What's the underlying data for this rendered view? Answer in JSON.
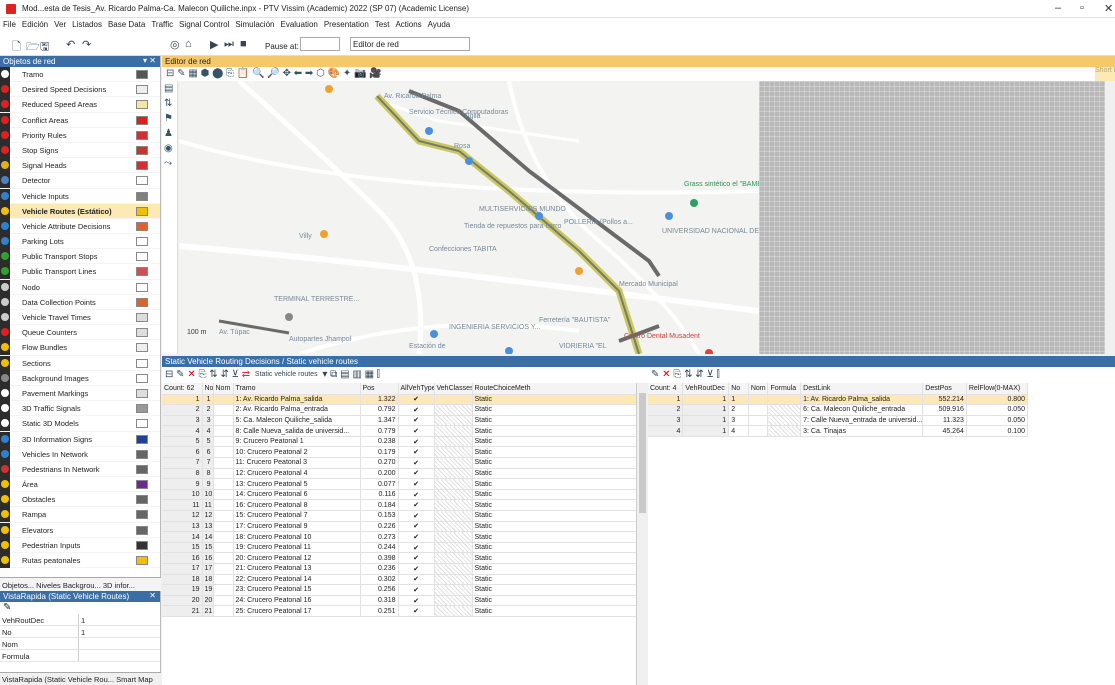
{
  "title": "Mod...esta de Tesis_Av. Ricardo Palma-Ca. Malecon Quiliche.inpx - PTV Vissim (Academic) 2022 (SP 07) (Academic License)",
  "menu": [
    "File",
    "Edición",
    "Ver",
    "Listados",
    "Base Data",
    "Traffic",
    "Signal Control",
    "Simulación",
    "Evaluation",
    "Presentation",
    "Test",
    "Actions",
    "Ayuda"
  ],
  "toolbar": {
    "pause_label": "Pause at:",
    "editor_select": "Editor de red"
  },
  "left_panel": {
    "title": "Objetos de red",
    "items": [
      {
        "label": "Tramo",
        "color": "#555555",
        "icon": "#ffffff"
      },
      {
        "label": "Desired Speed Decisions",
        "color": "#eeeeee",
        "icon": "#e02020"
      },
      {
        "label": "Reduced Speed Areas",
        "color": "#f4e7a1",
        "icon": "#e02020"
      },
      {
        "label": "Conflict Areas",
        "color": "#e02020",
        "icon": "#e02020"
      },
      {
        "label": "Priority Rules",
        "color": "#d03030",
        "icon": "#e02020"
      },
      {
        "label": "Stop Signs",
        "color": "#d03030",
        "icon": "#e02020"
      },
      {
        "label": "Signal Heads",
        "color": "#d03030",
        "icon": "#e0b020"
      },
      {
        "label": "Detector",
        "color": "#ffffff",
        "icon": "#5080c0"
      },
      {
        "label": "Vehicle Inputs",
        "color": "#808080",
        "icon": "#3080d0"
      },
      {
        "label": "Vehicle Routes (Estático)",
        "color": "#f0c000",
        "icon": "#f0c000",
        "selected": true
      },
      {
        "label": "Vehicle Attribute Decisions",
        "color": "#e06030",
        "icon": "#3080d0"
      },
      {
        "label": "Parking Lots",
        "color": "#ffffff",
        "icon": "#3080d0"
      },
      {
        "label": "Public Transport Stops",
        "color": "#ffffff",
        "icon": "#30a030"
      },
      {
        "label": "Public Transport Lines",
        "color": "#d05050",
        "icon": "#30a030"
      },
      {
        "label": "Nodo",
        "color": "#ffffff",
        "icon": "#cccccc"
      },
      {
        "label": "Data Collection Points",
        "color": "#e06030",
        "icon": "#cccccc"
      },
      {
        "label": "Vehicle Travel Times",
        "color": "#dddddd",
        "icon": "#cccccc"
      },
      {
        "label": "Queue Counters",
        "color": "#dddddd",
        "icon": "#e02020"
      },
      {
        "label": "Flow Bundles",
        "color": "#eeeeee",
        "icon": "#f0c000"
      },
      {
        "label": "Sections",
        "color": "#ffffff",
        "icon": "#f0c000"
      },
      {
        "label": "Background Images",
        "color": "#ffffff",
        "icon": "#888888"
      },
      {
        "label": "Pavement Markings",
        "color": "#dddddd",
        "icon": "#ffffff"
      },
      {
        "label": "3D Traffic Signals",
        "color": "#999999",
        "icon": "#ffffff"
      },
      {
        "label": "Static 3D Models",
        "color": "#ffffff",
        "icon": "#ffffff"
      },
      {
        "label": "3D Information Signs",
        "color": "#2040a0",
        "icon": "#3080d0"
      },
      {
        "label": "Vehicles In Network",
        "color": "#666666",
        "icon": "#3080d0"
      },
      {
        "label": "Pedestrians In Network",
        "color": "#666666",
        "icon": "#d03030"
      },
      {
        "label": "Área",
        "color": "#6a2a90",
        "icon": "#f0c000"
      },
      {
        "label": "Obstacles",
        "color": "#666666",
        "icon": "#f0c000"
      },
      {
        "label": "Rampa",
        "color": "#666666",
        "icon": "#f0c000"
      },
      {
        "label": "Elevators",
        "color": "#666666",
        "icon": "#f0c000"
      },
      {
        "label": "Pedestrian Inputs",
        "color": "#333333",
        "icon": "#f0c000"
      },
      {
        "label": "Rutas peatonales",
        "color": "#f0c000",
        "icon": "#f0c000"
      }
    ],
    "tabs": "Objetos... Niveles Backgrou... 3D infor..."
  },
  "quick_view": {
    "title": "VistaRapida (Static Vehicle Routes)",
    "rows": [
      {
        "k": "VehRoutDec",
        "v": "1"
      },
      {
        "k": "No",
        "v": "1"
      },
      {
        "k": "Nom",
        "v": ""
      },
      {
        "k": "Formula",
        "v": ""
      }
    ],
    "tabs": "VistaRapida (Static Vehicle Rou... Smart Map"
  },
  "editor": {
    "title": "Editor de red",
    "short": "Short h",
    "scale": "100 m",
    "map_labels": [
      "Servicio Técnico Computadoras",
      "Tiglla",
      "Rosa",
      "MULTISERVICIOS MUNDO",
      "Tienda de repuestos para carro",
      "Villy",
      "Confecciones TABITA",
      "TERMINAL TERRESTRE...",
      "Autopartes Jhampol",
      "Estación de",
      "INGENIERIA SERVICIOS Y...",
      "Ferretería \"BAUTISTA\"",
      "VIDRIERIA \"EL",
      "Centro Dental Musadent",
      "Mercado Municipal",
      "UNIVERSIDAD NACIONAL DE...",
      "Grass sintético el \"BAMBACHO\"",
      "POLLERÍA (Pollos a...",
      "Av. Ricardo Palma",
      "Av. Túpac"
    ]
  },
  "routing": {
    "title": "Static Vehicle Routing Decisions / Static vehicle routes",
    "dropdown": "Static vehicle routes",
    "left_headers": [
      "Count: 62",
      "No",
      "Nom",
      "Tramo",
      "Pos",
      "AllVehTypes",
      "VehClasses",
      "RouteChoiceMeth"
    ],
    "left_rows": [
      [
        "1",
        "1",
        "",
        "1: Av. Ricardo Palma_salida",
        "1.322",
        "✔",
        "",
        "Static"
      ],
      [
        "2",
        "2",
        "",
        "2: Av. Ricardo Palma_entrada",
        "0.792",
        "✔",
        "",
        "Static"
      ],
      [
        "3",
        "3",
        "",
        "5: Ca. Malecon Quiliche_salida",
        "1.347",
        "✔",
        "",
        "Static"
      ],
      [
        "4",
        "4",
        "",
        "8: Calle Nueva_salida de universid...",
        "0.779",
        "✔",
        "",
        "Static"
      ],
      [
        "5",
        "5",
        "",
        "9: Crucero Peatonal 1",
        "0.238",
        "✔",
        "",
        "Static"
      ],
      [
        "6",
        "6",
        "",
        "10: Crucero Peatonal 2",
        "0.179",
        "✔",
        "",
        "Static"
      ],
      [
        "7",
        "7",
        "",
        "11: Crucero Peatonal 3",
        "0.270",
        "✔",
        "",
        "Static"
      ],
      [
        "8",
        "8",
        "",
        "12: Crucero Peatonal 4",
        "0.200",
        "✔",
        "",
        "Static"
      ],
      [
        "9",
        "9",
        "",
        "13: Crucero Peatonal 5",
        "0.077",
        "✔",
        "",
        "Static"
      ],
      [
        "10",
        "10",
        "",
        "14: Crucero Peatonal 6",
        "0.116",
        "✔",
        "",
        "Static"
      ],
      [
        "11",
        "11",
        "",
        "16: Crucero Peatonal 8",
        "0.184",
        "✔",
        "",
        "Static"
      ],
      [
        "12",
        "12",
        "",
        "15: Crucero Peatonal 7",
        "0.153",
        "✔",
        "",
        "Static"
      ],
      [
        "13",
        "13",
        "",
        "17: Crucero Peatonal 9",
        "0.226",
        "✔",
        "",
        "Static"
      ],
      [
        "14",
        "14",
        "",
        "18: Crucero Peatonal 10",
        "0.273",
        "✔",
        "",
        "Static"
      ],
      [
        "15",
        "15",
        "",
        "19: Crucero Peatonal 11",
        "0.244",
        "✔",
        "",
        "Static"
      ],
      [
        "16",
        "16",
        "",
        "20: Crucero Peatonal 12",
        "0.398",
        "✔",
        "",
        "Static"
      ],
      [
        "17",
        "17",
        "",
        "21: Crucero Peatonal 13",
        "0.236",
        "✔",
        "",
        "Static"
      ],
      [
        "18",
        "18",
        "",
        "22: Crucero Peatonal 14",
        "0.302",
        "✔",
        "",
        "Static"
      ],
      [
        "19",
        "19",
        "",
        "23: Crucero Peatonal 15",
        "0.256",
        "✔",
        "",
        "Static"
      ],
      [
        "20",
        "20",
        "",
        "24: Crucero Peatonal 16",
        "0.318",
        "✔",
        "",
        "Static"
      ],
      [
        "21",
        "21",
        "",
        "25: Crucero Peatonal 17",
        "0.251",
        "✔",
        "",
        "Static"
      ]
    ],
    "right_headers": [
      "Count: 4",
      "VehRoutDec",
      "No",
      "Nom",
      "Formula",
      "DestLink",
      "DestPos",
      "RelFlow(0-MAX)"
    ],
    "right_rows": [
      [
        "1",
        "1",
        "1",
        "",
        "",
        "1: Av. Ricardo Palma_salida",
        "552.214",
        "0.800"
      ],
      [
        "2",
        "1",
        "2",
        "",
        "",
        "6: Ca. Malecon Quiliche_entrada",
        "509.916",
        "0.050"
      ],
      [
        "3",
        "1",
        "3",
        "",
        "",
        "7: Calle Nueva_entrada de universid...",
        "11.323",
        "0.050"
      ],
      [
        "4",
        "1",
        "4",
        "",
        "",
        "3: Ca. Tinajas",
        "45.264",
        "0.100"
      ]
    ]
  }
}
